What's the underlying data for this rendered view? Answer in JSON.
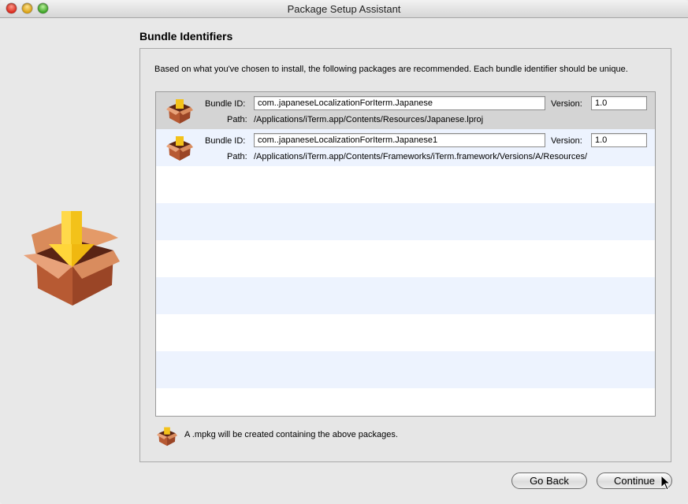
{
  "window": {
    "title": "Package Setup Assistant"
  },
  "traffic_lights": [
    "close",
    "minimize",
    "zoom"
  ],
  "section": {
    "heading": "Bundle Identifiers"
  },
  "description": "Based on what you've chosen to install, the following packages are recommended.  Each bundle identifier should be unique.",
  "packages": [
    {
      "bundle_label": "Bundle ID:",
      "bundle_id": "com..japaneseLocalizationForIterm.Japanese",
      "version_label": "Version:",
      "version": "1.0",
      "path_label": "Path:",
      "path": "/Applications/iTerm.app/Contents/Resources/Japanese.lproj",
      "selected": true
    },
    {
      "bundle_label": "Bundle ID:",
      "bundle_id": "com..japaneseLocalizationForIterm.Japanese1",
      "version_label": "Version:",
      "version": "1.0",
      "path_label": "Path:",
      "path": "/Applications/iTerm.app/Contents/Frameworks/iTerm.framework/Versions/A/Resources/",
      "selected": false
    }
  ],
  "footer": {
    "note": "A .mpkg will be created containing the above packages."
  },
  "buttons": {
    "back": "Go Back",
    "continue": "Continue"
  },
  "colors": {
    "selected_row": "#d4d4d4",
    "alt_row": "#edf3fe",
    "box_accent": "#f5c518"
  }
}
